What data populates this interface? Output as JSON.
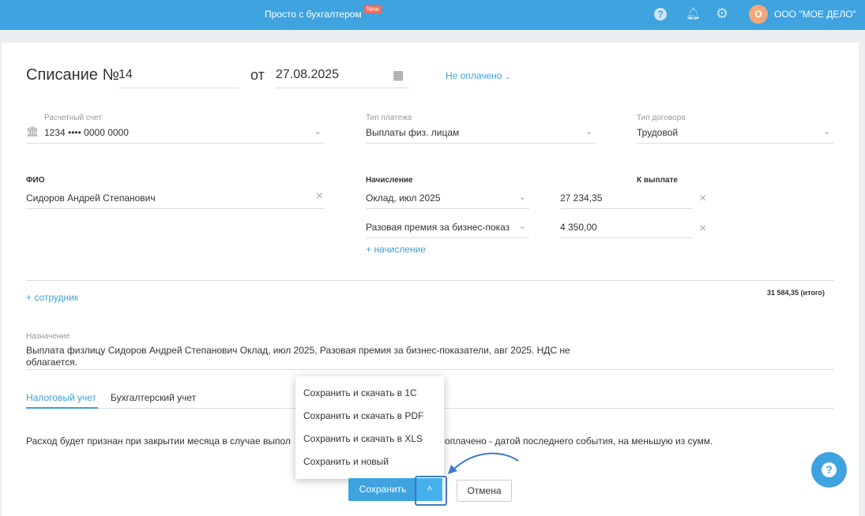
{
  "header": {
    "title": "Просто с бухгалтером",
    "badge": "New",
    "avatar": "О",
    "company": "ООО \"МОЕ ДЕЛО\""
  },
  "doc": {
    "title": "Списание №",
    "number": "14",
    "from": "от",
    "date": "27.08.2025",
    "status": "Не оплачено"
  },
  "account": {
    "label": "Расчетный счет",
    "value": "1234 •••• 0000 0000"
  },
  "payment_type": {
    "label": "Тип платежа",
    "value": "Выплаты физ. лицам"
  },
  "contract_type": {
    "label": "Тип договора",
    "value": "Трудовой"
  },
  "fio": {
    "label": "ФИО",
    "value": "Сидоров Андрей Степанович"
  },
  "accrual": {
    "label": "Начисление",
    "pay_label": "К выплате",
    "rows": [
      {
        "name": "Оклад, июл 2025",
        "amount": "27 234,35"
      },
      {
        "name": "Разовая премия за бизнес-показ",
        "amount": "4 350,00"
      }
    ],
    "add": "+ начисление"
  },
  "add_employee": "+ сотрудник",
  "total": "31 584,35 (итого)",
  "purpose": {
    "label": "Назначение",
    "line1": "Выплата физлицу Сидоров Андрей Степанович Оклад, июл 2025, Разовая премия за бизнес-показатели, авг 2025. НДС не",
    "line2": "облагается."
  },
  "tabs": [
    "Налоговый учет",
    "Бухгалтерский учет"
  ],
  "note": {
    "part1": "Расход будет признан при закрытии месяца в случае выпол",
    "part2": "оплачено - датой последнего события, на меньшую из сумм."
  },
  "menu": [
    "Сохранить и скачать в 1С",
    "Сохранить и скачать в PDF",
    "Сохранить и скачать в XLS",
    "Сохранить и новый"
  ],
  "buttons": {
    "save": "Сохранить",
    "cancel": "Отмена"
  }
}
